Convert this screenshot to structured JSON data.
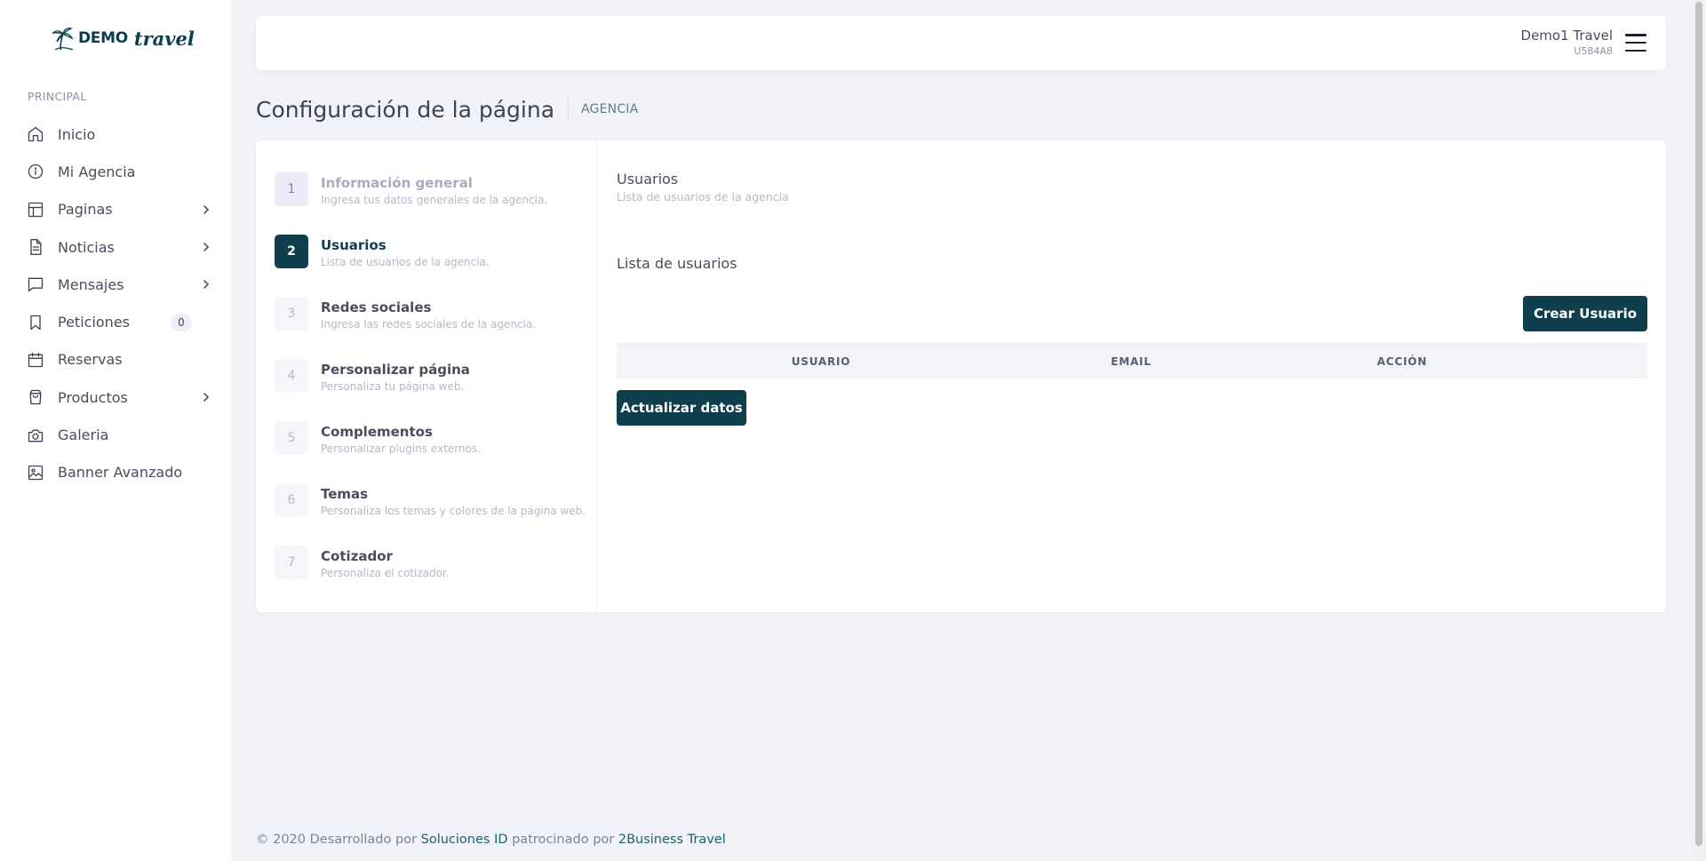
{
  "brand": {
    "name": "DEMO",
    "script": "travel"
  },
  "sidebar": {
    "section_label": "PRINCIPAL",
    "items": [
      {
        "label": "Inicio",
        "icon": "home-icon"
      },
      {
        "label": "Mi Agencia",
        "icon": "info-icon"
      },
      {
        "label": "Paginas",
        "icon": "layout-icon",
        "has_children": true
      },
      {
        "label": "Noticias",
        "icon": "file-text-icon",
        "has_children": true
      },
      {
        "label": "Mensajes",
        "icon": "message-icon",
        "has_children": true
      },
      {
        "label": "Peticiones",
        "icon": "bookmark-icon",
        "badge": "0"
      },
      {
        "label": "Reservas",
        "icon": "calendar-icon"
      },
      {
        "label": "Productos",
        "icon": "shopping-bag-icon",
        "has_children": true
      },
      {
        "label": "Galeria",
        "icon": "camera-icon"
      },
      {
        "label": "Banner Avanzado",
        "icon": "image-icon"
      }
    ]
  },
  "header": {
    "user_name": "Demo1 Travel",
    "user_code": "U584A8"
  },
  "page": {
    "title": "Configuración de la página",
    "subtitle": "AGENCIA"
  },
  "steps": [
    {
      "number": "1",
      "title": "Información general",
      "desc": "Ingresa tus datos generales de la agencia.",
      "state": "done"
    },
    {
      "number": "2",
      "title": "Usuarios",
      "desc": "Lista de usuarios de la agencia.",
      "state": "active"
    },
    {
      "number": "3",
      "title": "Redes sociales",
      "desc": "Ingresa las redes sociales de la agencia.",
      "state": "pending"
    },
    {
      "number": "4",
      "title": "Personalizar página",
      "desc": "Personaliza tu página web.",
      "state": "pending"
    },
    {
      "number": "5",
      "title": "Complementos",
      "desc": "Personalizar plugins externos.",
      "state": "pending"
    },
    {
      "number": "6",
      "title": "Temas",
      "desc": "Personaliza los temas y colores de la página web.",
      "state": "pending"
    },
    {
      "number": "7",
      "title": "Cotizador",
      "desc": "Personaliza el cotizador.",
      "state": "pending"
    }
  ],
  "content": {
    "section_title": "Usuarios",
    "section_desc": "Lista de usuarios de la agencia",
    "list_title": "Lista de usuarios",
    "create_button": "Crear Usuario",
    "update_button": "Actualizar datos",
    "table_headers": [
      "USUARIO",
      "EMAIL",
      "ACCIÓN"
    ]
  },
  "footer": {
    "prefix": "© 2020 Desarrollado por",
    "link1": "Soluciones ID",
    "middle": "patrocinado por",
    "link2": "2Business Travel"
  },
  "colors": {
    "accent": "#0f3f4d",
    "background": "#f2f3f8"
  }
}
